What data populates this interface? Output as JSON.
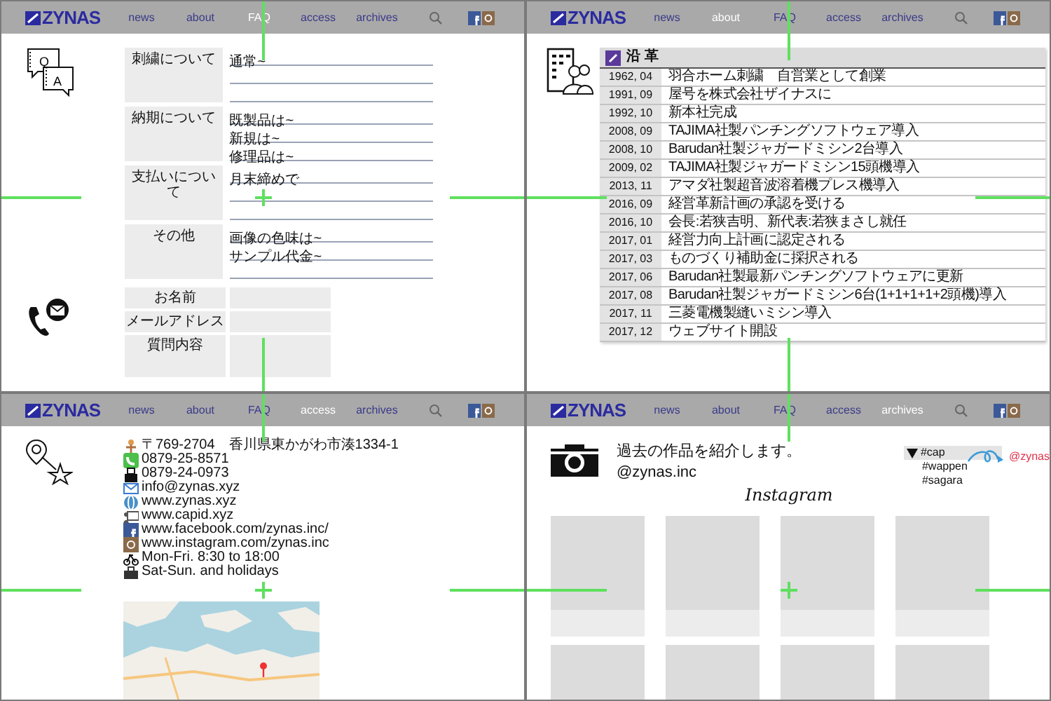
{
  "panels": [
    {
      "kind": "faq",
      "nav": {
        "logo": "ZYNAS",
        "items": [
          {
            "label": "news",
            "selected": false
          },
          {
            "label": "about",
            "selected": false
          },
          {
            "label": "FAQ",
            "selected": true
          },
          {
            "label": "access",
            "selected": false
          },
          {
            "label": "archives",
            "selected": false
          }
        ]
      },
      "icon_letters": [
        "Q",
        "A"
      ],
      "sections": [
        {
          "label": "刺繍について",
          "answers": [
            "通常~"
          ]
        },
        {
          "label": "納期について",
          "answers": [
            "既製品は~",
            "新規は~",
            "修理品は~"
          ]
        },
        {
          "label": "支払いについて",
          "answers": [
            "月末締めで"
          ]
        },
        {
          "label": "その他",
          "answers": [
            "画像の色味は~",
            "サンプル代金~"
          ]
        }
      ],
      "form": [
        {
          "label": "お名前",
          "kind": "line"
        },
        {
          "label": "メールアドレス",
          "kind": "line"
        },
        {
          "label": "質問内容",
          "kind": "area"
        }
      ]
    },
    {
      "kind": "history",
      "nav": {
        "logo": "ZYNAS",
        "items": [
          {
            "label": "news",
            "selected": false
          },
          {
            "label": "about",
            "selected": true
          },
          {
            "label": "FAQ",
            "selected": false
          },
          {
            "label": "access",
            "selected": false
          },
          {
            "label": "archives",
            "selected": false
          }
        ]
      },
      "title": "沿 革",
      "rows": [
        {
          "date": "1962, 04",
          "event": "羽合ホーム刺繍　自営業として創業"
        },
        {
          "date": "1991, 09",
          "event": "屋号を株式会社ザイナスに"
        },
        {
          "date": "1992, 10",
          "event": "新本社完成"
        },
        {
          "date": "2008, 09",
          "event": "TAJIMA社製パンチングソフトウェア導入"
        },
        {
          "date": "2008, 10",
          "event": "Barudan社製ジャガードミシン2台導入"
        },
        {
          "date": "2009, 02",
          "event": "TAJIMA社製ジャガードミシン15頭機導入"
        },
        {
          "date": "2013, 11",
          "event": "アマダ社製超音波溶着機プレス機導入"
        },
        {
          "date": "2016, 09",
          "event": "経営革新計画の承認を受ける"
        },
        {
          "date": "2016, 10",
          "event": "会長:若狭吉明、新代表:若狭まさし就任"
        },
        {
          "date": "2017, 01",
          "event": "経営力向上計画に認定される"
        },
        {
          "date": "2017, 03",
          "event": "ものづくり補助金に採択される"
        },
        {
          "date": "2017, 06",
          "event": "Barudan社製最新パンチングソフトウェアに更新"
        },
        {
          "date": "2017, 08",
          "event": "Barudan社製ジャガードミシン6台(1+1+1+1+2頭機)導入"
        },
        {
          "date": "2017, 11",
          "event": "三菱電機製縫いミシン導入"
        },
        {
          "date": "2017, 12",
          "event": "ウェブサイト開設"
        }
      ]
    },
    {
      "kind": "access",
      "nav": {
        "logo": "ZYNAS",
        "items": [
          {
            "label": "news",
            "selected": false
          },
          {
            "label": "about",
            "selected": false
          },
          {
            "label": "FAQ",
            "selected": false
          },
          {
            "label": "access",
            "selected": true
          },
          {
            "label": "archives",
            "selected": false
          }
        ]
      },
      "items": [
        {
          "kind": "address",
          "text": "〒769-2704　香川県東かがわ市湊1334-1"
        },
        {
          "kind": "phone",
          "text": "0879-25-8571"
        },
        {
          "kind": "fax",
          "text": "0879-24-0973"
        },
        {
          "kind": "mail",
          "text": "info@zynas.xyz"
        },
        {
          "kind": "web",
          "text": "www.zynas.xyz"
        },
        {
          "kind": "site",
          "text": "www.capid.xyz"
        },
        {
          "kind": "facebook",
          "text": "www.facebook.com/zynas.inc/"
        },
        {
          "kind": "instagram",
          "text": "www.instagram.com/zynas.inc"
        },
        {
          "kind": "hours",
          "text": "Mon-Fri. 8:30 to 18:00"
        },
        {
          "kind": "holiday",
          "text": "Sat-Sun. and holidays"
        }
      ]
    },
    {
      "kind": "archive",
      "nav": {
        "logo": "ZYNAS",
        "items": [
          {
            "label": "news",
            "selected": false
          },
          {
            "label": "about",
            "selected": false
          },
          {
            "label": "FAQ",
            "selected": false
          },
          {
            "label": "access",
            "selected": false
          },
          {
            "label": "archives",
            "selected": true
          }
        ]
      },
      "intro": "過去の作品を紹介します。",
      "account": "@zynas.inc",
      "heading": "Instagram",
      "tags": [
        {
          "label": "#cap",
          "selected": true
        },
        {
          "label": "#wappen",
          "selected": false
        },
        {
          "label": "#sagara",
          "selected": false
        }
      ],
      "link": "@zynas",
      "posts": [
        {
          "kind": "placeholder"
        },
        {
          "kind": "placeholder"
        },
        {
          "kind": "placeholder"
        },
        {
          "kind": "placeholder"
        },
        {
          "kind": "placeholder"
        },
        {
          "kind": "placeholder"
        },
        {
          "kind": "placeholder"
        },
        {
          "kind": "placeholder"
        }
      ]
    }
  ]
}
